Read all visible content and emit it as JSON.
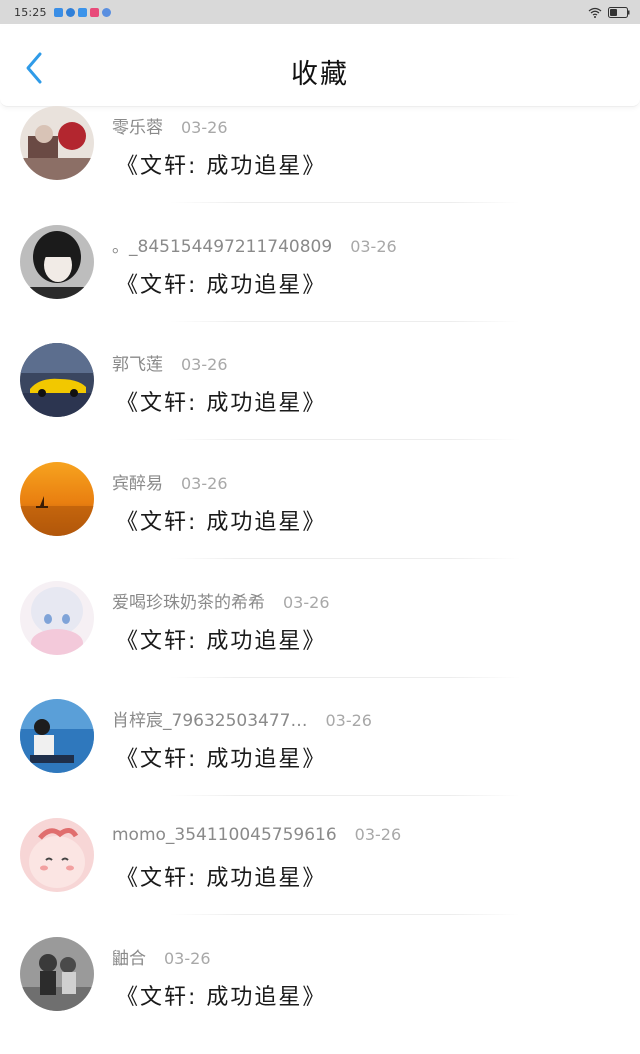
{
  "status_bar": {
    "time": "15:25"
  },
  "header": {
    "title": "收藏"
  },
  "items": [
    {
      "username": "零乐蓉",
      "date": "03-26",
      "message": "《文轩: 成功追星》",
      "avatar": "avatar-photo"
    },
    {
      "username": "。_845154497211740809",
      "date": "03-26",
      "message": "《文轩: 成功追星》",
      "avatar": "avatar-photo"
    },
    {
      "username": "郭飞莲",
      "date": "03-26",
      "message": "《文轩: 成功追星》",
      "avatar": "avatar-photo"
    },
    {
      "username": "宾醉易",
      "date": "03-26",
      "message": "《文轩: 成功追星》",
      "avatar": "avatar-photo"
    },
    {
      "username": "爱喝珍珠奶茶的希希",
      "date": "03-26",
      "message": "《文轩: 成功追星》",
      "avatar": "avatar-photo"
    },
    {
      "username": "肖梓宸_79632503477…",
      "date": "03-26",
      "message": "《文轩: 成功追星》",
      "avatar": "avatar-photo"
    },
    {
      "username": "momo_354110045759616",
      "date": "03-26",
      "message": "《文轩: 成功追星》",
      "avatar": "avatar-photo"
    },
    {
      "username": "鼬合",
      "date": "03-26",
      "message": "《文轩: 成功追星》",
      "avatar": "avatar-photo"
    }
  ],
  "colors": {
    "accent": "#2f9be8",
    "status_bar_bg": "#d9d9d9"
  }
}
